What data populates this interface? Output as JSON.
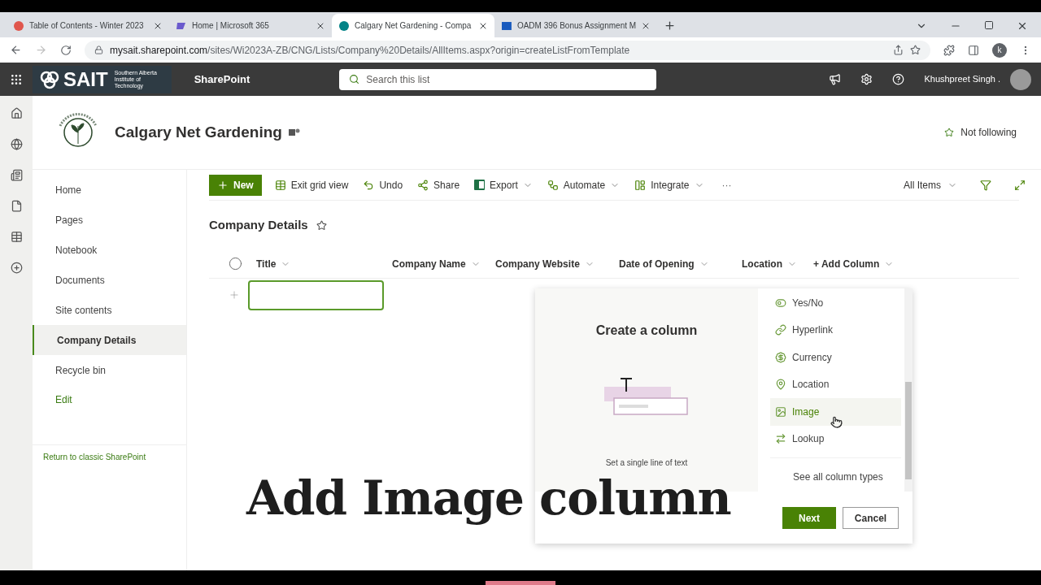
{
  "browser": {
    "tabs": [
      {
        "title": "Table of Contents - Winter 2023",
        "selected": false
      },
      {
        "title": "Home | Microsoft 365",
        "selected": false
      },
      {
        "title": "Calgary Net Gardening - Compa",
        "selected": true
      },
      {
        "title": "OADM 396 Bonus Assignment M",
        "selected": false
      }
    ],
    "url_domain": "mysait.sharepoint.com",
    "url_path": "/sites/Wi2023A-ZB/CNG/Lists/Company%20Details/AllItems.aspx?origin=createListFromTemplate",
    "profile_letter": "k"
  },
  "suite_bar": {
    "brand": "SAIT",
    "brand_sub": "Southern Alberta Institute of Technology",
    "app": "SharePoint",
    "search_placeholder": "Search this list",
    "user": "Khushpreet Singh ."
  },
  "site": {
    "title": "Calgary Net Gardening",
    "follow": "Not following"
  },
  "nav": {
    "items": [
      {
        "label": "Home",
        "selected": false
      },
      {
        "label": "Pages",
        "selected": false
      },
      {
        "label": "Notebook",
        "selected": false
      },
      {
        "label": "Documents",
        "selected": false
      },
      {
        "label": "Site contents",
        "selected": false
      },
      {
        "label": "Company Details",
        "selected": true
      },
      {
        "label": "Recycle bin",
        "selected": false
      }
    ],
    "edit": "Edit",
    "classic": "Return to classic SharePoint"
  },
  "command_bar": {
    "items": [
      {
        "label": "New",
        "kind": "primary"
      },
      {
        "label": "Exit grid view",
        "kind": "button"
      },
      {
        "label": "Undo",
        "kind": "button"
      },
      {
        "label": "Share",
        "kind": "button"
      },
      {
        "label": "Export",
        "kind": "menu"
      },
      {
        "label": "Automate",
        "kind": "menu"
      },
      {
        "label": "Integrate",
        "kind": "menu"
      }
    ],
    "more": "···",
    "view": "All Items"
  },
  "list": {
    "title": "Company Details",
    "select_all_checked": false,
    "columns": [
      "Title",
      "Company Name",
      "Company Website",
      "Date of Opening",
      "Location"
    ],
    "add_column": "+ Add Column"
  },
  "panel": {
    "title": "Create a column",
    "description": "Set a single line of text",
    "types": [
      {
        "label": "Yes/No",
        "selected": false
      },
      {
        "label": "Hyperlink",
        "selected": false
      },
      {
        "label": "Currency",
        "selected": false
      },
      {
        "label": "Location",
        "selected": false
      },
      {
        "label": "Image",
        "selected": true
      },
      {
        "label": "Lookup",
        "selected": false
      }
    ],
    "see_all": "See all column types",
    "buttons": [
      {
        "label": "Next",
        "kind": "primary"
      },
      {
        "label": "Cancel",
        "kind": "default"
      }
    ]
  },
  "caption": "Add Image column"
}
